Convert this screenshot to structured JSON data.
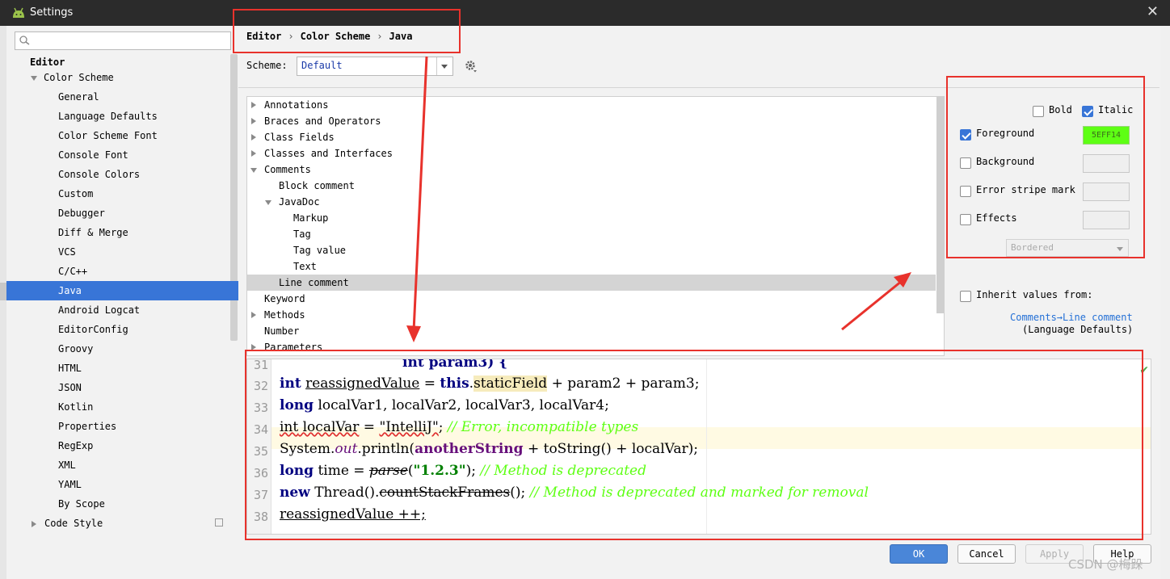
{
  "window": {
    "title": "Settings",
    "close_glyph": "✕"
  },
  "sidebar": {
    "search_placeholder": "",
    "root": "Editor",
    "color_scheme": "Color Scheme",
    "items": [
      "General",
      "Language Defaults",
      "Color Scheme Font",
      "Console Font",
      "Console Colors",
      "Custom",
      "Debugger",
      "Diff & Merge",
      "VCS",
      "C/C++",
      "Java",
      "Android Logcat",
      "EditorConfig",
      "Groovy",
      "HTML",
      "JSON",
      "Kotlin",
      "Properties",
      "RegExp",
      "XML",
      "YAML",
      "By Scope"
    ],
    "selected": "Java",
    "code_style": "Code Style"
  },
  "breadcrumb": {
    "a": "Editor",
    "b": "Color Scheme",
    "c": "Java",
    "sep": "›"
  },
  "scheme": {
    "label": "Scheme:",
    "value": "Default"
  },
  "attributes": {
    "annotations": "Annotations",
    "braces": "Braces and Operators",
    "class_fields": "Class Fields",
    "classes": "Classes and Interfaces",
    "comments": "Comments",
    "block_comment": "Block comment",
    "javadoc": "JavaDoc",
    "markup": "Markup",
    "tag": "Tag",
    "tag_value": "Tag value",
    "text": "Text",
    "line_comment": "Line comment",
    "keyword": "Keyword",
    "methods": "Methods",
    "number": "Number",
    "parameters": "Parameters"
  },
  "options": {
    "bold": "Bold",
    "italic": "Italic",
    "foreground": "Foreground",
    "foreground_color": "5EFF14",
    "background": "Background",
    "error_stripe": "Error stripe mark",
    "effects": "Effects",
    "effect_type": "Bordered",
    "inherit": "Inherit values from:",
    "inherit_link": "Comments→Line comment",
    "inherit_sub": "(Language Defaults)"
  },
  "editor": {
    "lines": [
      "31",
      "32",
      "33",
      "34",
      "35",
      "36",
      "37",
      "38"
    ],
    "l31": "int param3) {",
    "l32_kw": "int",
    "l32_var": "reassignedValue",
    "l32_eq": " = ",
    "l32_this": "this",
    "l32_dot": ".",
    "l32_field": "staticField",
    "l32_rest": " + param2 + param3;",
    "l33_kw": "long",
    "l33_rest": " localVar1, localVar2, localVar3, localVar4;",
    "l34_kw": "int",
    "l34_var": " localVar",
    "l34_eq": " = ",
    "l34_str": "\"IntelliJ\"",
    "l34_semi": "; ",
    "l34_cmt": "// Error, incompatible types",
    "l35_a": "System.",
    "l35_out": "out",
    "l35_b": ".println(",
    "l35_c": "anotherString",
    "l35_d": " + toString() + localVar);",
    "l36_kw": "long",
    "l36_a": " time = ",
    "l36_parse": "parse",
    "l36_b": "(",
    "l36_str": "\"1.2.3\"",
    "l36_c": "); ",
    "l36_cmt": "// Method is deprecated",
    "l37_kw": "new",
    "l37_a": " Thread().",
    "l37_b": "countStackFrames",
    "l37_c": "(); ",
    "l37_cmt": "// Method is deprecated and marked for removal",
    "l38": "reassignedValue ++;"
  },
  "buttons": {
    "ok": "OK",
    "cancel": "Cancel",
    "apply": "Apply",
    "help": "Help"
  },
  "watermark": "CSDN @梅跺",
  "colors": {
    "accent": "#3875D7",
    "annotation_red": "#E8322C",
    "comment_green": "#5EFF14"
  }
}
